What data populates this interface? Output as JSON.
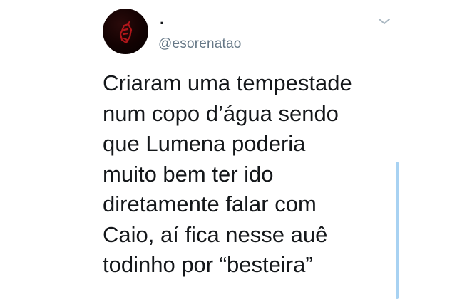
{
  "tweet": {
    "display_name": ".",
    "handle": "@esorenatao",
    "text": "Criaram uma tempestade\nnum copo d’água sendo\nque Lumena poderia\nmuito bem ter ido\ndiretamente falar com\nCaio, aí fica nesse auê\ntodinho por “besteira”"
  },
  "icons": {
    "menu": "chevron-down-icon",
    "avatar": "avatar-image"
  },
  "colors": {
    "text": "#14171a",
    "handle": "#657786",
    "caret": "#aab8c2",
    "scrollbar": "#a8d2f2",
    "avatar_bg": "#120202",
    "avatar_mark": "#b0161a"
  }
}
